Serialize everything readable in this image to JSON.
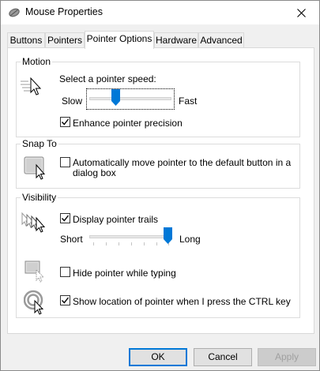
{
  "window": {
    "title": "Mouse Properties"
  },
  "tabs": [
    {
      "label": "Buttons"
    },
    {
      "label": "Pointers"
    },
    {
      "label": "Pointer Options"
    },
    {
      "label": "Hardware"
    },
    {
      "label": "Advanced"
    }
  ],
  "motion": {
    "group_label": "Motion",
    "speed_label": "Select a pointer speed:",
    "slow_label": "Slow",
    "fast_label": "Fast",
    "speed_value": 0.36,
    "enhance_label": "Enhance pointer precision",
    "enhance_checked": true
  },
  "snap_to": {
    "group_label": "Snap To",
    "auto_label_line1": "Automatically move pointer to the default button in a",
    "auto_label_line2": "dialog box",
    "auto_checked": false
  },
  "visibility": {
    "group_label": "Visibility",
    "trails_label": "Display pointer trails",
    "trails_checked": true,
    "short_label": "Short",
    "long_label": "Long",
    "trails_value": 1.0,
    "hide_label": "Hide pointer while typing",
    "hide_checked": false,
    "show_location_label": "Show location of pointer when I press the CTRL key",
    "show_location_checked": true
  },
  "buttons": {
    "ok": "OK",
    "cancel": "Cancel",
    "apply": "Apply"
  },
  "colors": {
    "accent": "#0078d7",
    "border": "#dcdcdc"
  }
}
